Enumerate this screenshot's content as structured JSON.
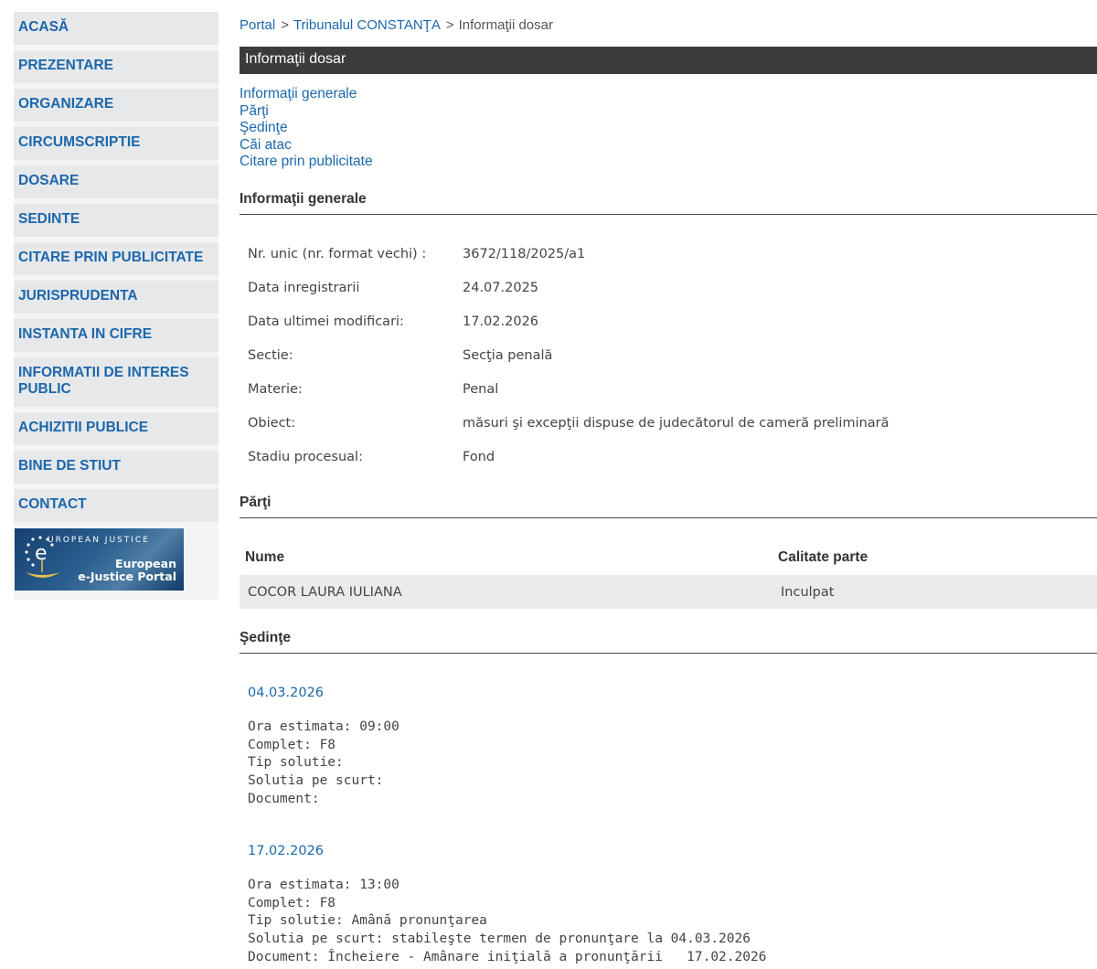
{
  "sidebar": {
    "items": [
      {
        "label": "ACASĂ"
      },
      {
        "label": "PREZENTARE"
      },
      {
        "label": "ORGANIZARE"
      },
      {
        "label": "CIRCUMSCRIPTIE"
      },
      {
        "label": "DOSARE"
      },
      {
        "label": "SEDINTE"
      },
      {
        "label": "CITARE PRIN PUBLICITATE"
      },
      {
        "label": "JURISPRUDENTA"
      },
      {
        "label": "INSTANTA IN CIFRE"
      },
      {
        "label": "INFORMATII DE INTERES PUBLIC"
      },
      {
        "label": "ACHIZITII PUBLICE"
      },
      {
        "label": "BINE DE STIUT"
      },
      {
        "label": "CONTACT"
      }
    ],
    "logo": {
      "top_text": "UROPEAN JUSTICE",
      "portal_text_1": "European",
      "portal_text_2": "e-Justice Portal"
    }
  },
  "breadcrumb": {
    "portal": "Portal",
    "court": "Tribunalul CONSTANŢA",
    "current": "Informaţii dosar",
    "separator": ">"
  },
  "title_bar": "Informaţii dosar",
  "section_links": [
    "Informaţii generale",
    "Părţi",
    "Şedinţe",
    "Căi atac",
    "Citare prin publicitate"
  ],
  "general": {
    "heading": "Informaţii generale",
    "rows": [
      {
        "label": "Nr. unic (nr. format vechi) :",
        "value": "3672/118/2025/a1"
      },
      {
        "label": "Data inregistrarii",
        "value": "24.07.2025"
      },
      {
        "label": "Data ultimei modificari:",
        "value": "17.02.2026"
      },
      {
        "label": "Sectie:",
        "value": "Secţia penală"
      },
      {
        "label": "Materie:",
        "value": "Penal"
      },
      {
        "label": "Obiect:",
        "value": "măsuri şi excepţii dispuse de judecătorul de cameră preliminară"
      },
      {
        "label": "Stadiu procesual:",
        "value": "Fond"
      }
    ]
  },
  "parties": {
    "heading": "Părţi",
    "columns": {
      "name": "Nume",
      "role": "Calitate parte"
    },
    "rows": [
      {
        "name": "COCOR LAURA IULIANA",
        "role": "Inculpat"
      }
    ]
  },
  "hearings": {
    "heading": "Şedinţe",
    "items": [
      {
        "date": "04.03.2026",
        "lines": [
          "Ora estimata: 09:00",
          "Complet: F8",
          "Tip solutie:",
          "Solutia pe scurt:",
          "Document:"
        ]
      },
      {
        "date": "17.02.2026",
        "lines": [
          "Ora estimata: 13:00",
          "Complet: F8",
          "Tip solutie: Amână pronunţarea",
          "Solutia pe scurt: stabileşte termen de pronunţare la 04.03.2026",
          "Document: Încheiere - Amânare iniţială a pronunţării   17.02.2026"
        ]
      }
    ]
  }
}
